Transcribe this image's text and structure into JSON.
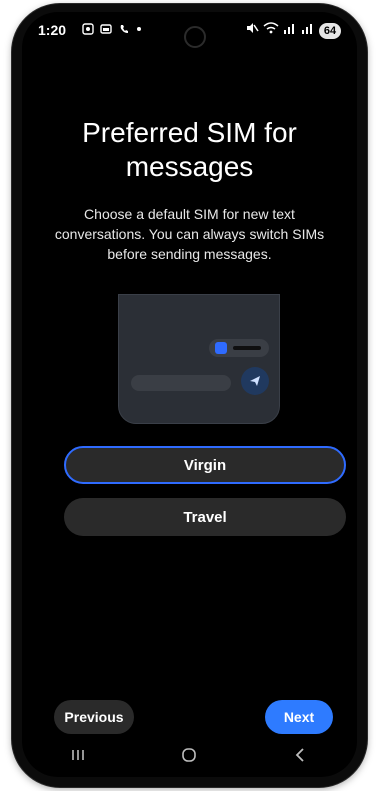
{
  "status_bar": {
    "time": "1:20",
    "battery": "64",
    "icons_left": [
      "screenshot-icon",
      "gallery-icon",
      "phone-icon",
      "dot-icon"
    ],
    "icons_right": [
      "mute-icon",
      "wifi-icon",
      "signal-icon",
      "signal-icon",
      "battery-icon"
    ]
  },
  "header": {
    "title_line1": "Preferred SIM for",
    "title_line2": "messages",
    "subtitle": "Choose a default SIM for new text conversations. You can always switch SIMs before sending messages."
  },
  "sim_options": [
    {
      "label": "Virgin",
      "selected": true
    },
    {
      "label": "Travel",
      "selected": false
    }
  ],
  "navigation": {
    "previous_label": "Previous",
    "next_label": "Next"
  },
  "colors": {
    "accent": "#2e7bff",
    "background": "#000000",
    "button_bg": "#2a2a2a"
  },
  "system_nav": {
    "icons": [
      "recents-icon",
      "home-icon",
      "back-icon"
    ]
  }
}
